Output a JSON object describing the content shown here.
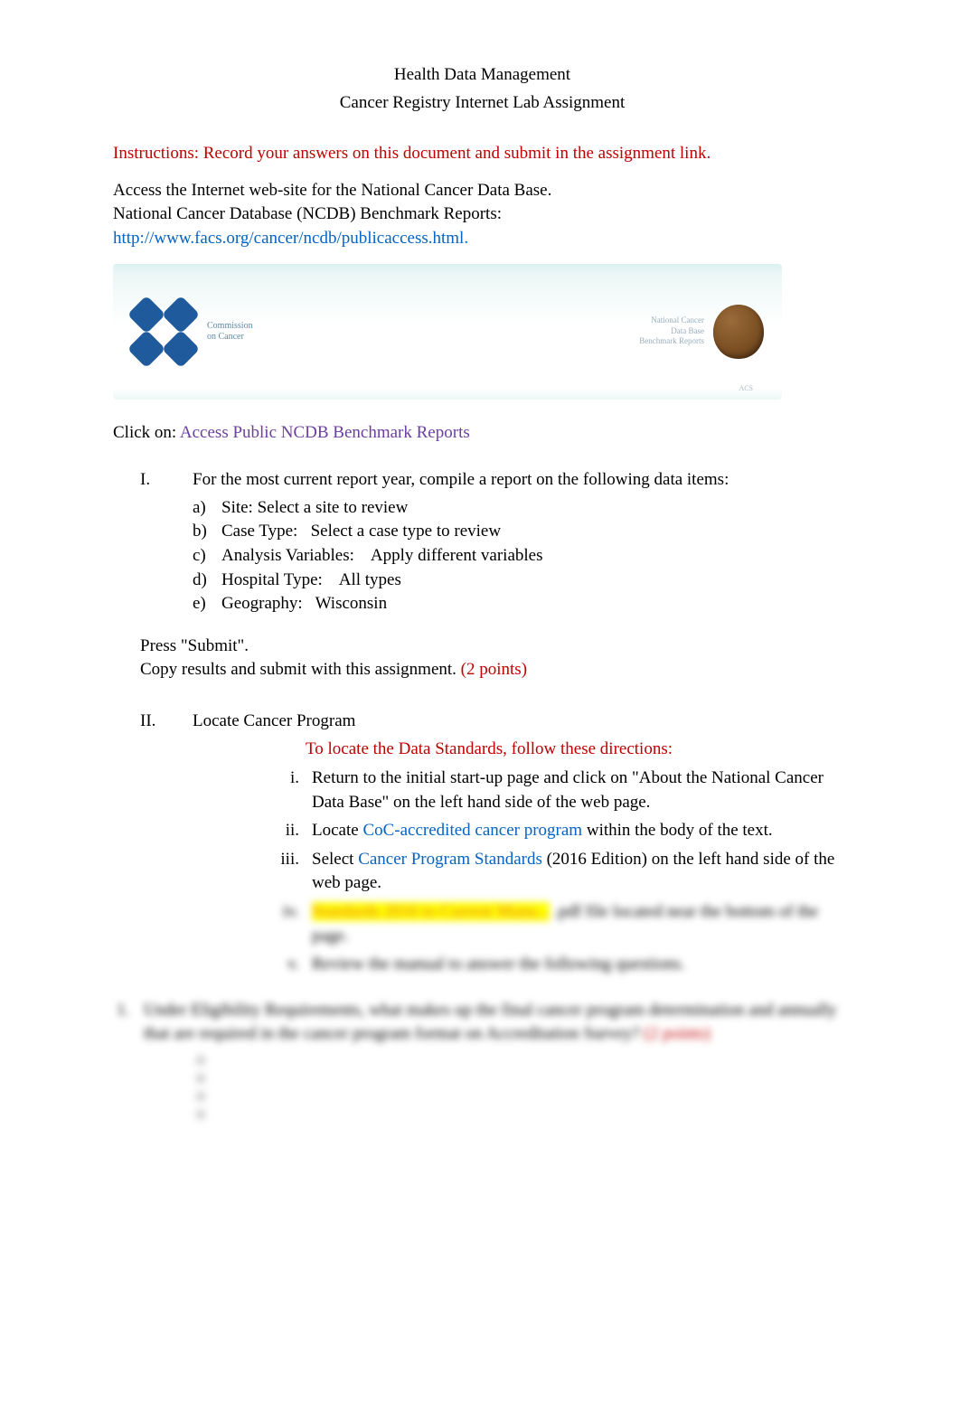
{
  "title": "Health Data Management",
  "subtitle": "Cancer Registry Internet Lab Assignment",
  "instructions": "Instructions:   Record your answers on this document and submit in the assignment link.",
  "access1": "Access the Internet web-site for the National Cancer Data Base.",
  "access2": "National Cancer Database (NCDB) Benchmark Reports:",
  "url": "http://www.facs.org/cancer/ncdb/publicaccess.html.",
  "logo": {
    "line1": "Commission",
    "line2": "on Cancer",
    "right1": "National Cancer",
    "right2": "Data Base",
    "right3": "Benchmark Reports",
    "sealLabel": "ACS"
  },
  "clickOnLabel": "Click on:  ",
  "clickOnLink": "Access Public NCDB Benchmark Reports",
  "sectionI": {
    "num": "I.",
    "intro": "For the most current report year, compile a report on the following data items:",
    "a": {
      "label": "a)",
      "key": "Site:",
      "val": "Select a site to review"
    },
    "b": {
      "label": "b)",
      "key": "Case Type:",
      "val": "Select a case type to review"
    },
    "c": {
      "label": "c)",
      "key": "Analysis Variables:",
      "val": "Apply different variables"
    },
    "d": {
      "label": "d)",
      "key": "Hospital Type:",
      "val": "All types"
    },
    "e": {
      "label": "e)",
      "key": "Geography:",
      "val": "Wisconsin"
    }
  },
  "press": "Press \"Submit\".",
  "copy": "Copy results and submit with this assignment.  ",
  "copyPts": "(2 points)",
  "sectionII": {
    "num": "II.",
    "title": "Locate Cancer Program",
    "redNote": "To locate the Data Standards, follow these directions:",
    "i": {
      "rn": "i.",
      "t1": "Return to the initial start-up page and click on \"About the National Cancer Data Base\" on the left hand side of the web page."
    },
    "ii": {
      "rn": "ii.",
      "t1": "Locate ",
      "link": "CoC-accredited cancer program",
      "t2": " within the body of the text."
    },
    "iii": {
      "rn": "iii.",
      "t1": "Select ",
      "link": "Cancer Program Standards",
      "t2": " (2016 Edition) on the left hand side of the web page."
    },
    "iv": {
      "rn": "iv.",
      "link": "Standards 2016 to Current Manu...",
      "t2": " .pdf file located near the bottom of the page."
    },
    "v": {
      "rn": "v.",
      "t1": "Review the manual to answer the following questions."
    }
  },
  "q1": {
    "num": "1.",
    "text": "Under Eligibility Requirements, what makes up the final cancer program determination and annually that are required in the cancer program format on Accreditation Survey?    ",
    "pts": "(2 points)"
  }
}
